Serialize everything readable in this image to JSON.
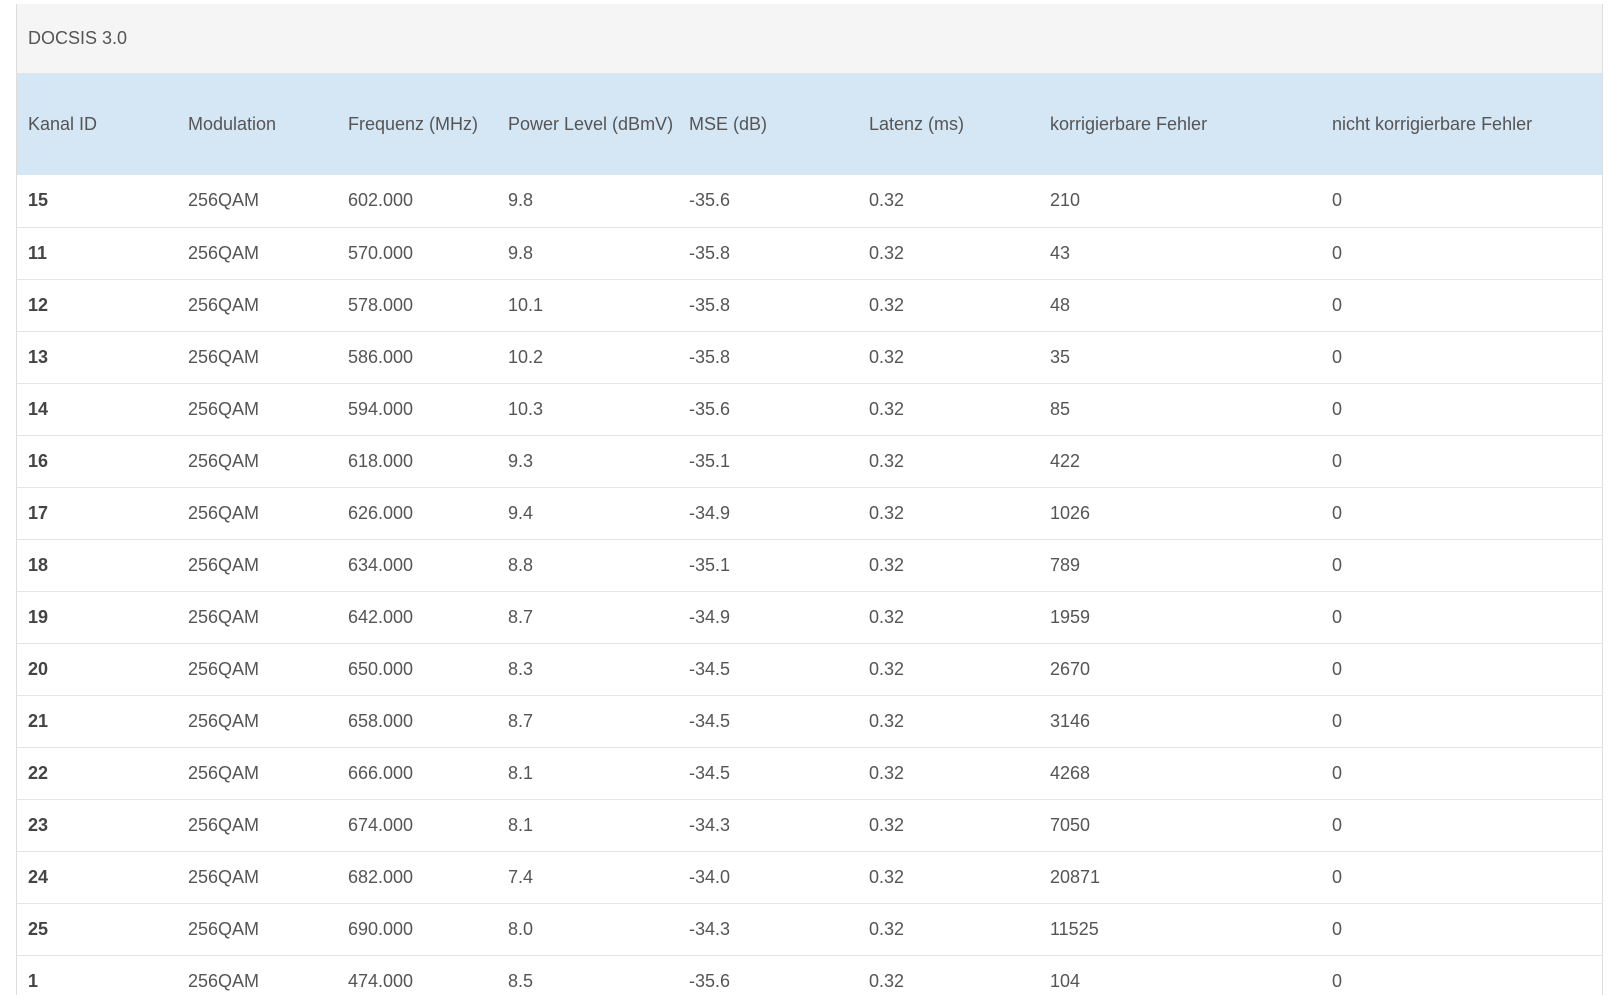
{
  "panel": {
    "title": "DOCSIS 3.0"
  },
  "table": {
    "headers": [
      "Kanal ID",
      "Modulation",
      "Frequenz (MHz)",
      "Power Level (dBmV)",
      "MSE (dB)",
      "Latenz (ms)",
      "korrigierbare Fehler",
      "nicht korrigierbare Fehler"
    ],
    "rows": [
      [
        "15",
        "256QAM",
        "602.000",
        "9.8",
        "-35.6",
        "0.32",
        "210",
        "0"
      ],
      [
        "11",
        "256QAM",
        "570.000",
        "9.8",
        "-35.8",
        "0.32",
        "43",
        "0"
      ],
      [
        "12",
        "256QAM",
        "578.000",
        "10.1",
        "-35.8",
        "0.32",
        "48",
        "0"
      ],
      [
        "13",
        "256QAM",
        "586.000",
        "10.2",
        "-35.8",
        "0.32",
        "35",
        "0"
      ],
      [
        "14",
        "256QAM",
        "594.000",
        "10.3",
        "-35.6",
        "0.32",
        "85",
        "0"
      ],
      [
        "16",
        "256QAM",
        "618.000",
        "9.3",
        "-35.1",
        "0.32",
        "422",
        "0"
      ],
      [
        "17",
        "256QAM",
        "626.000",
        "9.4",
        "-34.9",
        "0.32",
        "1026",
        "0"
      ],
      [
        "18",
        "256QAM",
        "634.000",
        "8.8",
        "-35.1",
        "0.32",
        "789",
        "0"
      ],
      [
        "19",
        "256QAM",
        "642.000",
        "8.7",
        "-34.9",
        "0.32",
        "1959",
        "0"
      ],
      [
        "20",
        "256QAM",
        "650.000",
        "8.3",
        "-34.5",
        "0.32",
        "2670",
        "0"
      ],
      [
        "21",
        "256QAM",
        "658.000",
        "8.7",
        "-34.5",
        "0.32",
        "3146",
        "0"
      ],
      [
        "22",
        "256QAM",
        "666.000",
        "8.1",
        "-34.5",
        "0.32",
        "4268",
        "0"
      ],
      [
        "23",
        "256QAM",
        "674.000",
        "8.1",
        "-34.3",
        "0.32",
        "7050",
        "0"
      ],
      [
        "24",
        "256QAM",
        "682.000",
        "7.4",
        "-34.0",
        "0.32",
        "20871",
        "0"
      ],
      [
        "25",
        "256QAM",
        "690.000",
        "8.0",
        "-34.3",
        "0.32",
        "11525",
        "0"
      ],
      [
        "1",
        "256QAM",
        "474.000",
        "8.5",
        "-35.6",
        "0.32",
        "104",
        "0"
      ]
    ]
  }
}
